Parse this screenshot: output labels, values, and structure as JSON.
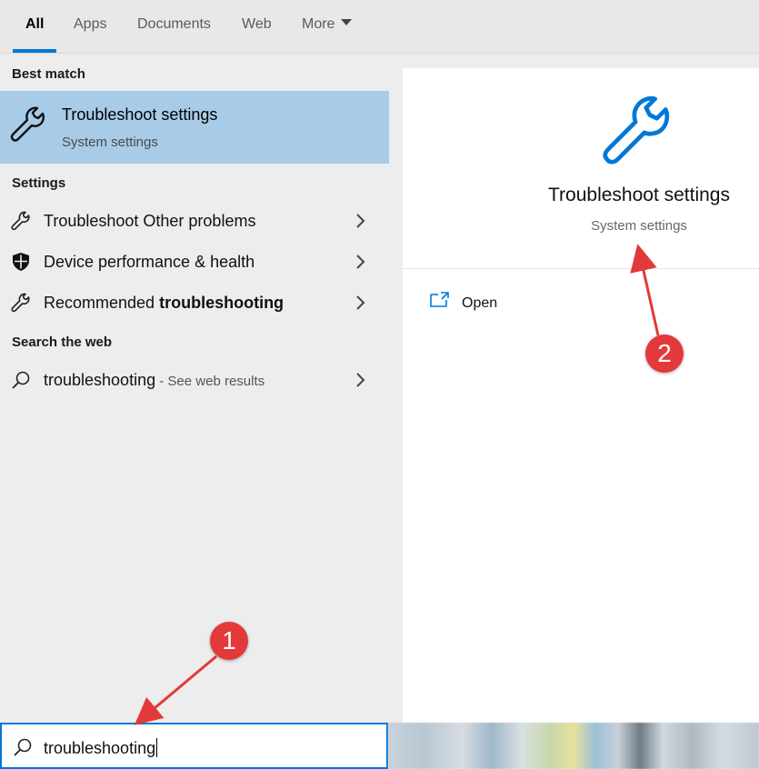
{
  "tabs": [
    {
      "label": "All",
      "active": true
    },
    {
      "label": "Apps"
    },
    {
      "label": "Documents"
    },
    {
      "label": "Web"
    },
    {
      "label": "More"
    }
  ],
  "left": {
    "best_match_label": "Best match",
    "best_match": {
      "title": "Troubleshoot settings",
      "subtitle": "System settings",
      "icon": "wrench-icon"
    },
    "settings_label": "Settings",
    "settings_items": [
      {
        "label": "Troubleshoot Other problems",
        "icon": "wrench-icon"
      },
      {
        "label": "Device performance & health",
        "icon": "shield-icon"
      },
      {
        "label_prefix": "Recommended ",
        "label_bold": "troubleshooting",
        "icon": "wrench-icon"
      }
    ],
    "web_label": "Search the web",
    "web_item": {
      "label": "troubleshooting",
      "suffix": " - See web results",
      "icon": "search-icon"
    }
  },
  "right": {
    "title": "Troubleshoot settings",
    "subtitle": "System settings",
    "icon": "wrench-icon",
    "actions": [
      {
        "label": "Open",
        "icon": "open-window-icon"
      }
    ]
  },
  "search": {
    "value": "troubleshooting",
    "icon": "search-icon"
  },
  "annotations": [
    {
      "label": "1"
    },
    {
      "label": "2"
    }
  ],
  "colors": {
    "accent": "#0078d7",
    "selection": "#a8cbe8",
    "callout": "#e3393a"
  }
}
